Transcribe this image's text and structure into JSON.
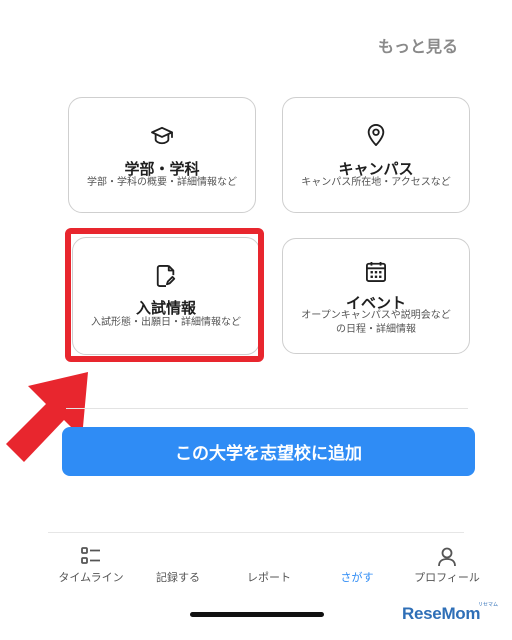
{
  "header": {
    "more_label": "もっと見る"
  },
  "cards": {
    "faculty": {
      "title": "学部・学科",
      "subtitle": "学部・学科の概要・詳細情報など",
      "icon": "graduation-cap-icon"
    },
    "campus": {
      "title": "キャンパス",
      "subtitle": "キャンパス所在地・アクセスなど",
      "icon": "location-pin-icon"
    },
    "admission": {
      "title": "入試情報",
      "subtitle": "入試形態・出願日・詳細情報など",
      "icon": "document-edit-icon"
    },
    "event": {
      "title": "イベント",
      "subtitle_line1": "オープンキャンパスや説明会など",
      "subtitle_line2": "の日程・詳細情報",
      "icon": "calendar-icon"
    }
  },
  "add_button": {
    "label": "この大学を志望校に追加"
  },
  "tabbar": {
    "items": [
      {
        "label": "タイムライン",
        "icon": "timeline-list-icon"
      },
      {
        "label": "記録する"
      },
      {
        "label": "レポート"
      },
      {
        "label": "さがす",
        "active": true
      },
      {
        "label": "プロフィール",
        "icon": "person-icon"
      }
    ]
  },
  "watermark": {
    "brand": "ReseMom",
    "small": "リセマム"
  },
  "colors": {
    "accent": "#2f8cf5",
    "highlight": "#e8262e"
  }
}
